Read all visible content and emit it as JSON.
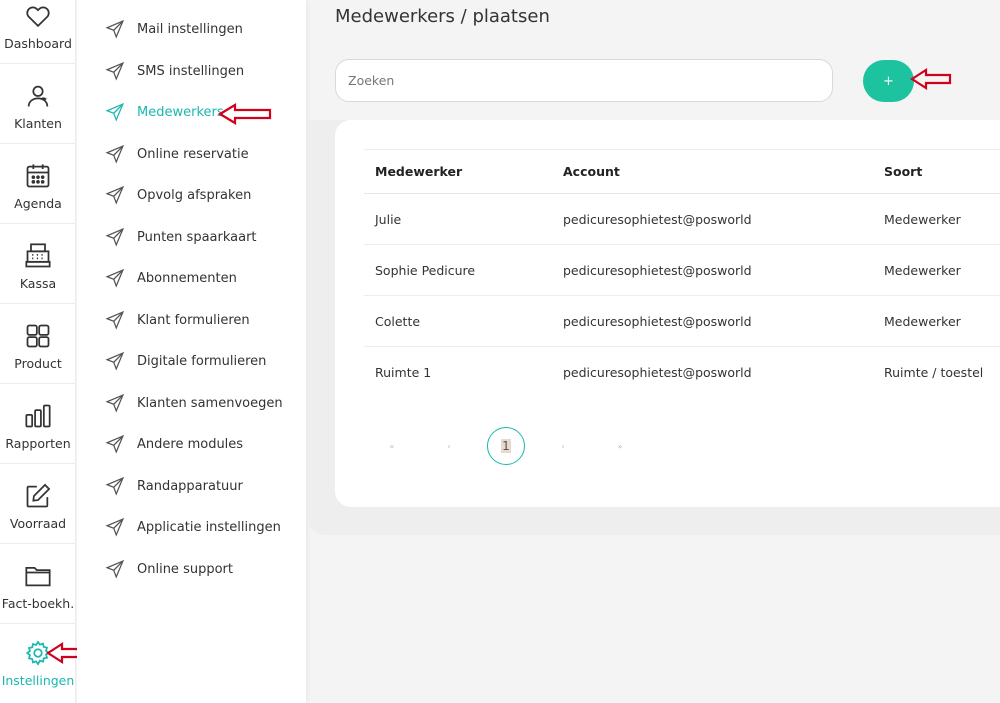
{
  "rail": {
    "items": [
      {
        "label": "Dashboard",
        "icon": "heart-icon"
      },
      {
        "label": "Klanten",
        "icon": "user-icon"
      },
      {
        "label": "Agenda",
        "icon": "calendar-icon"
      },
      {
        "label": "Kassa",
        "icon": "cash-register-icon"
      },
      {
        "label": "Product",
        "icon": "grid-icon"
      },
      {
        "label": "Rapporten",
        "icon": "bar-chart-icon"
      },
      {
        "label": "Voorraad",
        "icon": "edit-icon"
      },
      {
        "label": "Fact-boekh.",
        "icon": "folder-icon"
      },
      {
        "label": "Instellingen",
        "icon": "gear-icon"
      }
    ]
  },
  "submenu": {
    "items": [
      "Mail instellingen",
      "SMS instellingen",
      "Medewerkers",
      "Online reservatie",
      "Opvolg afspraken",
      "Punten spaarkaart",
      "Abonnementen",
      "Klant formulieren",
      "Digitale formulieren",
      "Klanten samenvoegen",
      "Andere modules",
      "Randapparatuur",
      "Applicatie instellingen",
      "Online support"
    ]
  },
  "page": {
    "title": "Medewerkers / plaatsen",
    "search_placeholder": "Zoeken",
    "add_label": "+"
  },
  "table": {
    "headers": [
      "Medewerker",
      "Account",
      "Soort"
    ],
    "rows": [
      [
        "Julie",
        "pedicuresophietest@posworld",
        "Medewerker"
      ],
      [
        "Sophie Pedicure",
        "pedicuresophietest@posworld",
        "Medewerker"
      ],
      [
        "Colette",
        "pedicuresophietest@posworld",
        "Medewerker"
      ],
      [
        "Ruimte 1",
        "pedicuresophietest@posworld",
        "Ruimte / toestel"
      ]
    ]
  },
  "pagination": {
    "first": "«",
    "prev": "‹",
    "current": "1",
    "next": "›",
    "last": "»"
  },
  "colors": {
    "accent": "#1ab8b0",
    "add_button": "#1dc39e",
    "annotation_arrow": "#d0021b"
  }
}
